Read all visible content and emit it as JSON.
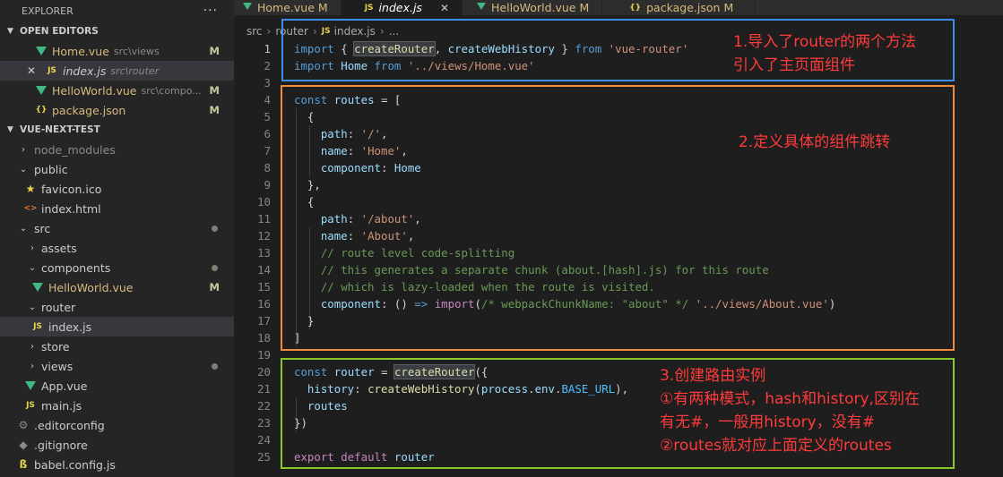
{
  "explorer": {
    "title": "EXPLORER",
    "more": "···",
    "open_editors": {
      "title": "OPEN EDITORS",
      "items": [
        {
          "name": "Home.vue",
          "path": "src\\views",
          "badge": "M",
          "icon": "vue-icon"
        },
        {
          "name": "index.js",
          "path": "src\\router",
          "badge": "",
          "icon": "js-icon",
          "close": "✕"
        },
        {
          "name": "HelloWorld.vue",
          "path": "src\\compo...",
          "badge": "M",
          "icon": "vue-icon"
        },
        {
          "name": "package.json",
          "path": "",
          "badge": "M",
          "icon": "json-icon"
        }
      ]
    },
    "project": {
      "title": "VUE-NEXT-TEST",
      "items": [
        {
          "name": "node_modules",
          "type": "folder"
        },
        {
          "name": "public",
          "type": "folder"
        },
        {
          "name": "favicon.ico",
          "icon": "star-icon"
        },
        {
          "name": "index.html",
          "icon": "html-icon"
        },
        {
          "name": "src",
          "type": "folder"
        },
        {
          "name": "assets",
          "type": "folder"
        },
        {
          "name": "components",
          "type": "folder"
        },
        {
          "name": "HelloWorld.vue",
          "icon": "vue-icon",
          "badge": "M"
        },
        {
          "name": "router",
          "type": "folder"
        },
        {
          "name": "index.js",
          "icon": "js-icon"
        },
        {
          "name": "store",
          "type": "folder"
        },
        {
          "name": "views",
          "type": "folder"
        },
        {
          "name": "App.vue",
          "icon": "vue-icon"
        },
        {
          "name": "main.js",
          "icon": "js-icon"
        },
        {
          "name": ".editorconfig",
          "icon": "gear-icon"
        },
        {
          "name": ".gitignore",
          "icon": "git-icon"
        },
        {
          "name": "babel.config.js",
          "icon": "babel-icon"
        }
      ]
    }
  },
  "tabs": [
    {
      "label": "Home.vue",
      "badge": "M"
    },
    {
      "label": "index.js",
      "badge": "",
      "close": "✕"
    },
    {
      "label": "HelloWorld.vue",
      "badge": "M"
    },
    {
      "label": "package.json",
      "badge": "M"
    }
  ],
  "breadcrumb": [
    "src",
    "router",
    "index.js",
    "..."
  ],
  "icon_labels": {
    "js": "JS",
    "json": "{}",
    "html": "<>"
  },
  "code_lines": [
    {
      "n": "1",
      "tokens": [
        [
          "k",
          "import"
        ],
        [
          "t",
          " { "
        ],
        [
          "fh",
          "createRouter"
        ],
        [
          "t",
          ", "
        ],
        [
          "v",
          "createWebHistory"
        ],
        [
          "t",
          " } "
        ],
        [
          "k",
          "from"
        ],
        [
          "t",
          " "
        ],
        [
          "s",
          "'vue-router'"
        ]
      ]
    },
    {
      "n": "2",
      "tokens": [
        [
          "k",
          "import"
        ],
        [
          "t",
          " "
        ],
        [
          "v",
          "Home"
        ],
        [
          "t",
          " "
        ],
        [
          "k",
          "from"
        ],
        [
          "t",
          " "
        ],
        [
          "s",
          "'../views/Home.vue'"
        ]
      ]
    },
    {
      "n": "3",
      "tokens": []
    },
    {
      "n": "4",
      "tokens": [
        [
          "k",
          "const"
        ],
        [
          "t",
          " "
        ],
        [
          "v",
          "routes"
        ],
        [
          "t",
          " = ["
        ]
      ]
    },
    {
      "n": "5",
      "tokens": [
        [
          "t",
          "  {"
        ]
      ]
    },
    {
      "n": "6",
      "tokens": [
        [
          "t",
          "    "
        ],
        [
          "v",
          "path"
        ],
        [
          "t",
          ": "
        ],
        [
          "s",
          "'/'"
        ],
        [
          "t",
          ","
        ]
      ]
    },
    {
      "n": "7",
      "tokens": [
        [
          "t",
          "    "
        ],
        [
          "v",
          "name"
        ],
        [
          "t",
          ": "
        ],
        [
          "s",
          "'Home'"
        ],
        [
          "t",
          ","
        ]
      ]
    },
    {
      "n": "8",
      "tokens": [
        [
          "t",
          "    "
        ],
        [
          "v",
          "component"
        ],
        [
          "t",
          ": "
        ],
        [
          "v",
          "Home"
        ]
      ]
    },
    {
      "n": "9",
      "tokens": [
        [
          "t",
          "  },"
        ]
      ]
    },
    {
      "n": "10",
      "tokens": [
        [
          "t",
          "  {"
        ]
      ]
    },
    {
      "n": "11",
      "tokens": [
        [
          "t",
          "    "
        ],
        [
          "v",
          "path"
        ],
        [
          "t",
          ": "
        ],
        [
          "s",
          "'/about'"
        ],
        [
          "t",
          ","
        ]
      ]
    },
    {
      "n": "12",
      "tokens": [
        [
          "t",
          "    "
        ],
        [
          "v",
          "name"
        ],
        [
          "t",
          ": "
        ],
        [
          "s",
          "'About'"
        ],
        [
          "t",
          ","
        ]
      ]
    },
    {
      "n": "13",
      "tokens": [
        [
          "t",
          "    "
        ],
        [
          "c",
          "// route level code-splitting"
        ]
      ]
    },
    {
      "n": "14",
      "tokens": [
        [
          "t",
          "    "
        ],
        [
          "c",
          "// this generates a separate chunk (about.[hash].js) for this route"
        ]
      ]
    },
    {
      "n": "15",
      "tokens": [
        [
          "t",
          "    "
        ],
        [
          "c",
          "// which is lazy-loaded when the route is visited."
        ]
      ]
    },
    {
      "n": "16",
      "tokens": [
        [
          "t",
          "    "
        ],
        [
          "v",
          "component"
        ],
        [
          "t",
          ": () "
        ],
        [
          "k",
          "=>"
        ],
        [
          "t",
          " "
        ],
        [
          "kc",
          "import"
        ],
        [
          "t",
          "("
        ],
        [
          "c",
          "/* webpackChunkName: \"about\" */"
        ],
        [
          "t",
          " "
        ],
        [
          "s",
          "'../views/About.vue'"
        ],
        [
          "t",
          ")"
        ]
      ]
    },
    {
      "n": "17",
      "tokens": [
        [
          "t",
          "  }"
        ]
      ]
    },
    {
      "n": "18",
      "tokens": [
        [
          "t",
          "]"
        ]
      ]
    },
    {
      "n": "19",
      "tokens": []
    },
    {
      "n": "20",
      "tokens": [
        [
          "k",
          "const"
        ],
        [
          "t",
          " "
        ],
        [
          "v",
          "router"
        ],
        [
          "t",
          " = "
        ],
        [
          "fhl",
          "createRouter"
        ],
        [
          "t",
          "({"
        ]
      ]
    },
    {
      "n": "21",
      "tokens": [
        [
          "t",
          "  "
        ],
        [
          "v",
          "history"
        ],
        [
          "t",
          ": "
        ],
        [
          "f",
          "createWebHistory"
        ],
        [
          "t",
          "("
        ],
        [
          "v",
          "process"
        ],
        [
          "t",
          "."
        ],
        [
          "v",
          "env"
        ],
        [
          "t",
          "."
        ],
        [
          "const",
          "BASE_URL"
        ],
        [
          "t",
          "),"
        ]
      ]
    },
    {
      "n": "22",
      "tokens": [
        [
          "t",
          "  "
        ],
        [
          "v",
          "routes"
        ]
      ]
    },
    {
      "n": "23",
      "tokens": [
        [
          "t",
          "})"
        ]
      ]
    },
    {
      "n": "24",
      "tokens": []
    },
    {
      "n": "25",
      "tokens": [
        [
          "kc",
          "export"
        ],
        [
          "t",
          " "
        ],
        [
          "kc",
          "default"
        ],
        [
          "t",
          " "
        ],
        [
          "v",
          "router"
        ]
      ]
    }
  ],
  "annotations": {
    "note1": [
      "1.导入了router的两个方法",
      "引入了主页面组件"
    ],
    "note2": [
      "2.定义具体的组件跳转"
    ],
    "note3": [
      "3.创建路由实例",
      "①有两种模式，hash和history,区别在",
      "有无#，一般用history，没有#",
      "②routes就对应上面定义的routes"
    ]
  },
  "colors": {
    "blue_box": "#3d8ee6",
    "orange_box": "#f08a3c",
    "green_box": "#8ac826",
    "note_text": "#ff3b3b"
  }
}
